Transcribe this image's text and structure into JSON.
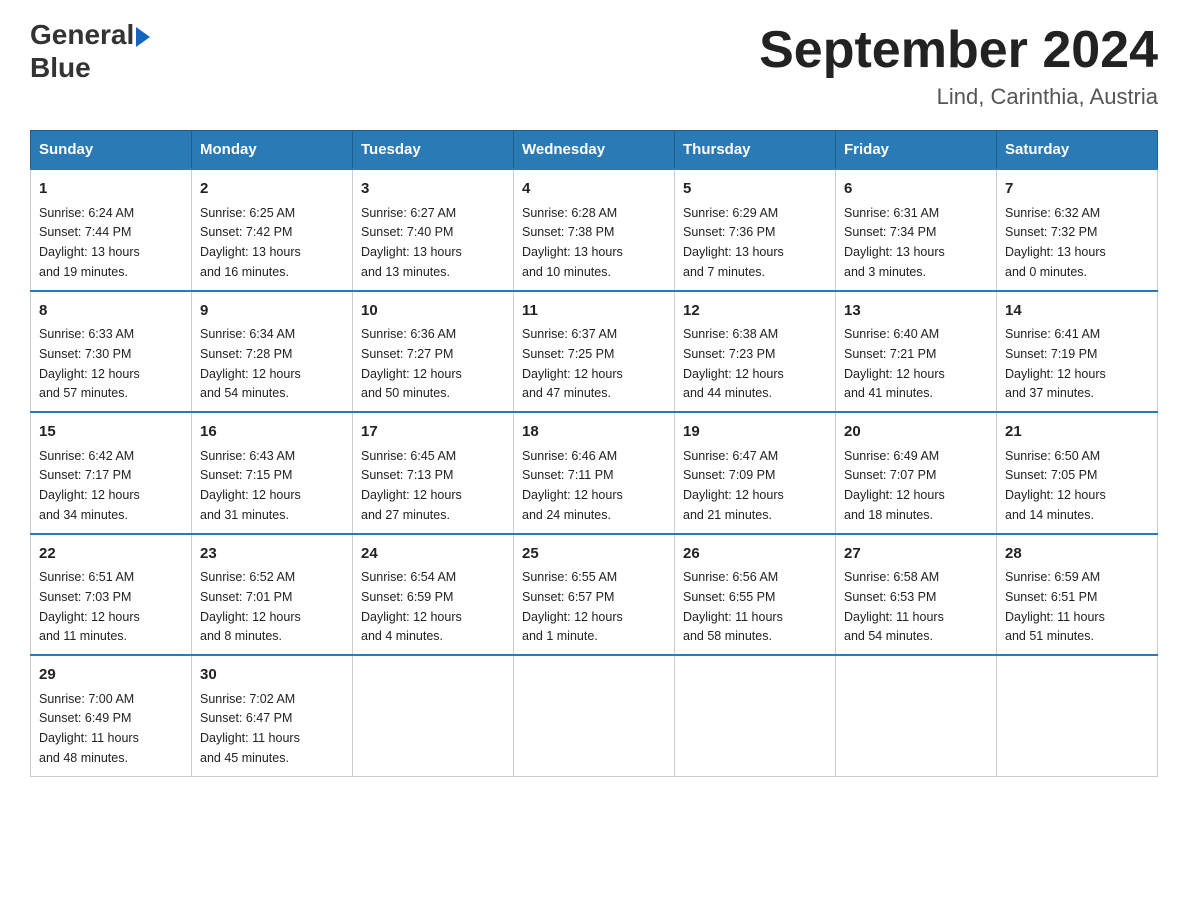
{
  "header": {
    "logo_line1": "General",
    "logo_line2": "Blue",
    "month_title": "September 2024",
    "location": "Lind, Carinthia, Austria"
  },
  "weekdays": [
    "Sunday",
    "Monday",
    "Tuesday",
    "Wednesday",
    "Thursday",
    "Friday",
    "Saturday"
  ],
  "weeks": [
    [
      {
        "day": "1",
        "info": "Sunrise: 6:24 AM\nSunset: 7:44 PM\nDaylight: 13 hours\nand 19 minutes."
      },
      {
        "day": "2",
        "info": "Sunrise: 6:25 AM\nSunset: 7:42 PM\nDaylight: 13 hours\nand 16 minutes."
      },
      {
        "day": "3",
        "info": "Sunrise: 6:27 AM\nSunset: 7:40 PM\nDaylight: 13 hours\nand 13 minutes."
      },
      {
        "day": "4",
        "info": "Sunrise: 6:28 AM\nSunset: 7:38 PM\nDaylight: 13 hours\nand 10 minutes."
      },
      {
        "day": "5",
        "info": "Sunrise: 6:29 AM\nSunset: 7:36 PM\nDaylight: 13 hours\nand 7 minutes."
      },
      {
        "day": "6",
        "info": "Sunrise: 6:31 AM\nSunset: 7:34 PM\nDaylight: 13 hours\nand 3 minutes."
      },
      {
        "day": "7",
        "info": "Sunrise: 6:32 AM\nSunset: 7:32 PM\nDaylight: 13 hours\nand 0 minutes."
      }
    ],
    [
      {
        "day": "8",
        "info": "Sunrise: 6:33 AM\nSunset: 7:30 PM\nDaylight: 12 hours\nand 57 minutes."
      },
      {
        "day": "9",
        "info": "Sunrise: 6:34 AM\nSunset: 7:28 PM\nDaylight: 12 hours\nand 54 minutes."
      },
      {
        "day": "10",
        "info": "Sunrise: 6:36 AM\nSunset: 7:27 PM\nDaylight: 12 hours\nand 50 minutes."
      },
      {
        "day": "11",
        "info": "Sunrise: 6:37 AM\nSunset: 7:25 PM\nDaylight: 12 hours\nand 47 minutes."
      },
      {
        "day": "12",
        "info": "Sunrise: 6:38 AM\nSunset: 7:23 PM\nDaylight: 12 hours\nand 44 minutes."
      },
      {
        "day": "13",
        "info": "Sunrise: 6:40 AM\nSunset: 7:21 PM\nDaylight: 12 hours\nand 41 minutes."
      },
      {
        "day": "14",
        "info": "Sunrise: 6:41 AM\nSunset: 7:19 PM\nDaylight: 12 hours\nand 37 minutes."
      }
    ],
    [
      {
        "day": "15",
        "info": "Sunrise: 6:42 AM\nSunset: 7:17 PM\nDaylight: 12 hours\nand 34 minutes."
      },
      {
        "day": "16",
        "info": "Sunrise: 6:43 AM\nSunset: 7:15 PM\nDaylight: 12 hours\nand 31 minutes."
      },
      {
        "day": "17",
        "info": "Sunrise: 6:45 AM\nSunset: 7:13 PM\nDaylight: 12 hours\nand 27 minutes."
      },
      {
        "day": "18",
        "info": "Sunrise: 6:46 AM\nSunset: 7:11 PM\nDaylight: 12 hours\nand 24 minutes."
      },
      {
        "day": "19",
        "info": "Sunrise: 6:47 AM\nSunset: 7:09 PM\nDaylight: 12 hours\nand 21 minutes."
      },
      {
        "day": "20",
        "info": "Sunrise: 6:49 AM\nSunset: 7:07 PM\nDaylight: 12 hours\nand 18 minutes."
      },
      {
        "day": "21",
        "info": "Sunrise: 6:50 AM\nSunset: 7:05 PM\nDaylight: 12 hours\nand 14 minutes."
      }
    ],
    [
      {
        "day": "22",
        "info": "Sunrise: 6:51 AM\nSunset: 7:03 PM\nDaylight: 12 hours\nand 11 minutes."
      },
      {
        "day": "23",
        "info": "Sunrise: 6:52 AM\nSunset: 7:01 PM\nDaylight: 12 hours\nand 8 minutes."
      },
      {
        "day": "24",
        "info": "Sunrise: 6:54 AM\nSunset: 6:59 PM\nDaylight: 12 hours\nand 4 minutes."
      },
      {
        "day": "25",
        "info": "Sunrise: 6:55 AM\nSunset: 6:57 PM\nDaylight: 12 hours\nand 1 minute."
      },
      {
        "day": "26",
        "info": "Sunrise: 6:56 AM\nSunset: 6:55 PM\nDaylight: 11 hours\nand 58 minutes."
      },
      {
        "day": "27",
        "info": "Sunrise: 6:58 AM\nSunset: 6:53 PM\nDaylight: 11 hours\nand 54 minutes."
      },
      {
        "day": "28",
        "info": "Sunrise: 6:59 AM\nSunset: 6:51 PM\nDaylight: 11 hours\nand 51 minutes."
      }
    ],
    [
      {
        "day": "29",
        "info": "Sunrise: 7:00 AM\nSunset: 6:49 PM\nDaylight: 11 hours\nand 48 minutes."
      },
      {
        "day": "30",
        "info": "Sunrise: 7:02 AM\nSunset: 6:47 PM\nDaylight: 11 hours\nand 45 minutes."
      },
      {
        "day": "",
        "info": ""
      },
      {
        "day": "",
        "info": ""
      },
      {
        "day": "",
        "info": ""
      },
      {
        "day": "",
        "info": ""
      },
      {
        "day": "",
        "info": ""
      }
    ]
  ]
}
